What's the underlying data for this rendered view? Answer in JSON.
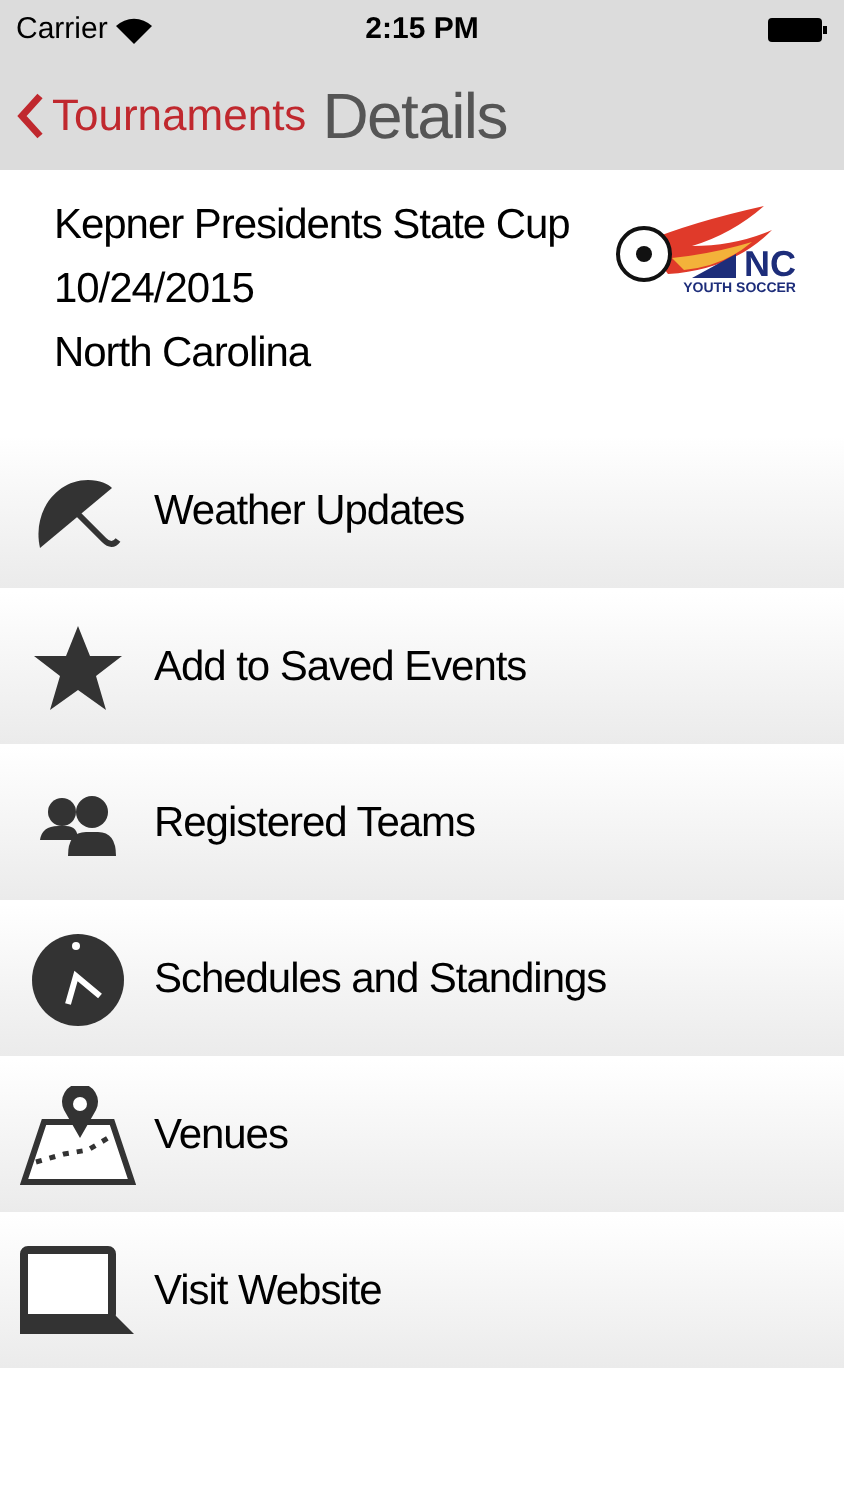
{
  "status_bar": {
    "carrier": "Carrier",
    "time": "2:15 PM"
  },
  "nav": {
    "back": "Tournaments",
    "title": "Details"
  },
  "event": {
    "name": "Kepner Presidents State Cup",
    "date": "10/24/2015",
    "location": "North Carolina",
    "logo": {
      "mark": "NC",
      "caption": "YOUTH SOCCER"
    }
  },
  "menu": [
    {
      "label": "Weather Updates"
    },
    {
      "label": "Add to Saved Events"
    },
    {
      "label": "Registered Teams"
    },
    {
      "label": "Schedules and Standings"
    },
    {
      "label": "Venues"
    },
    {
      "label": "Visit Website"
    }
  ]
}
